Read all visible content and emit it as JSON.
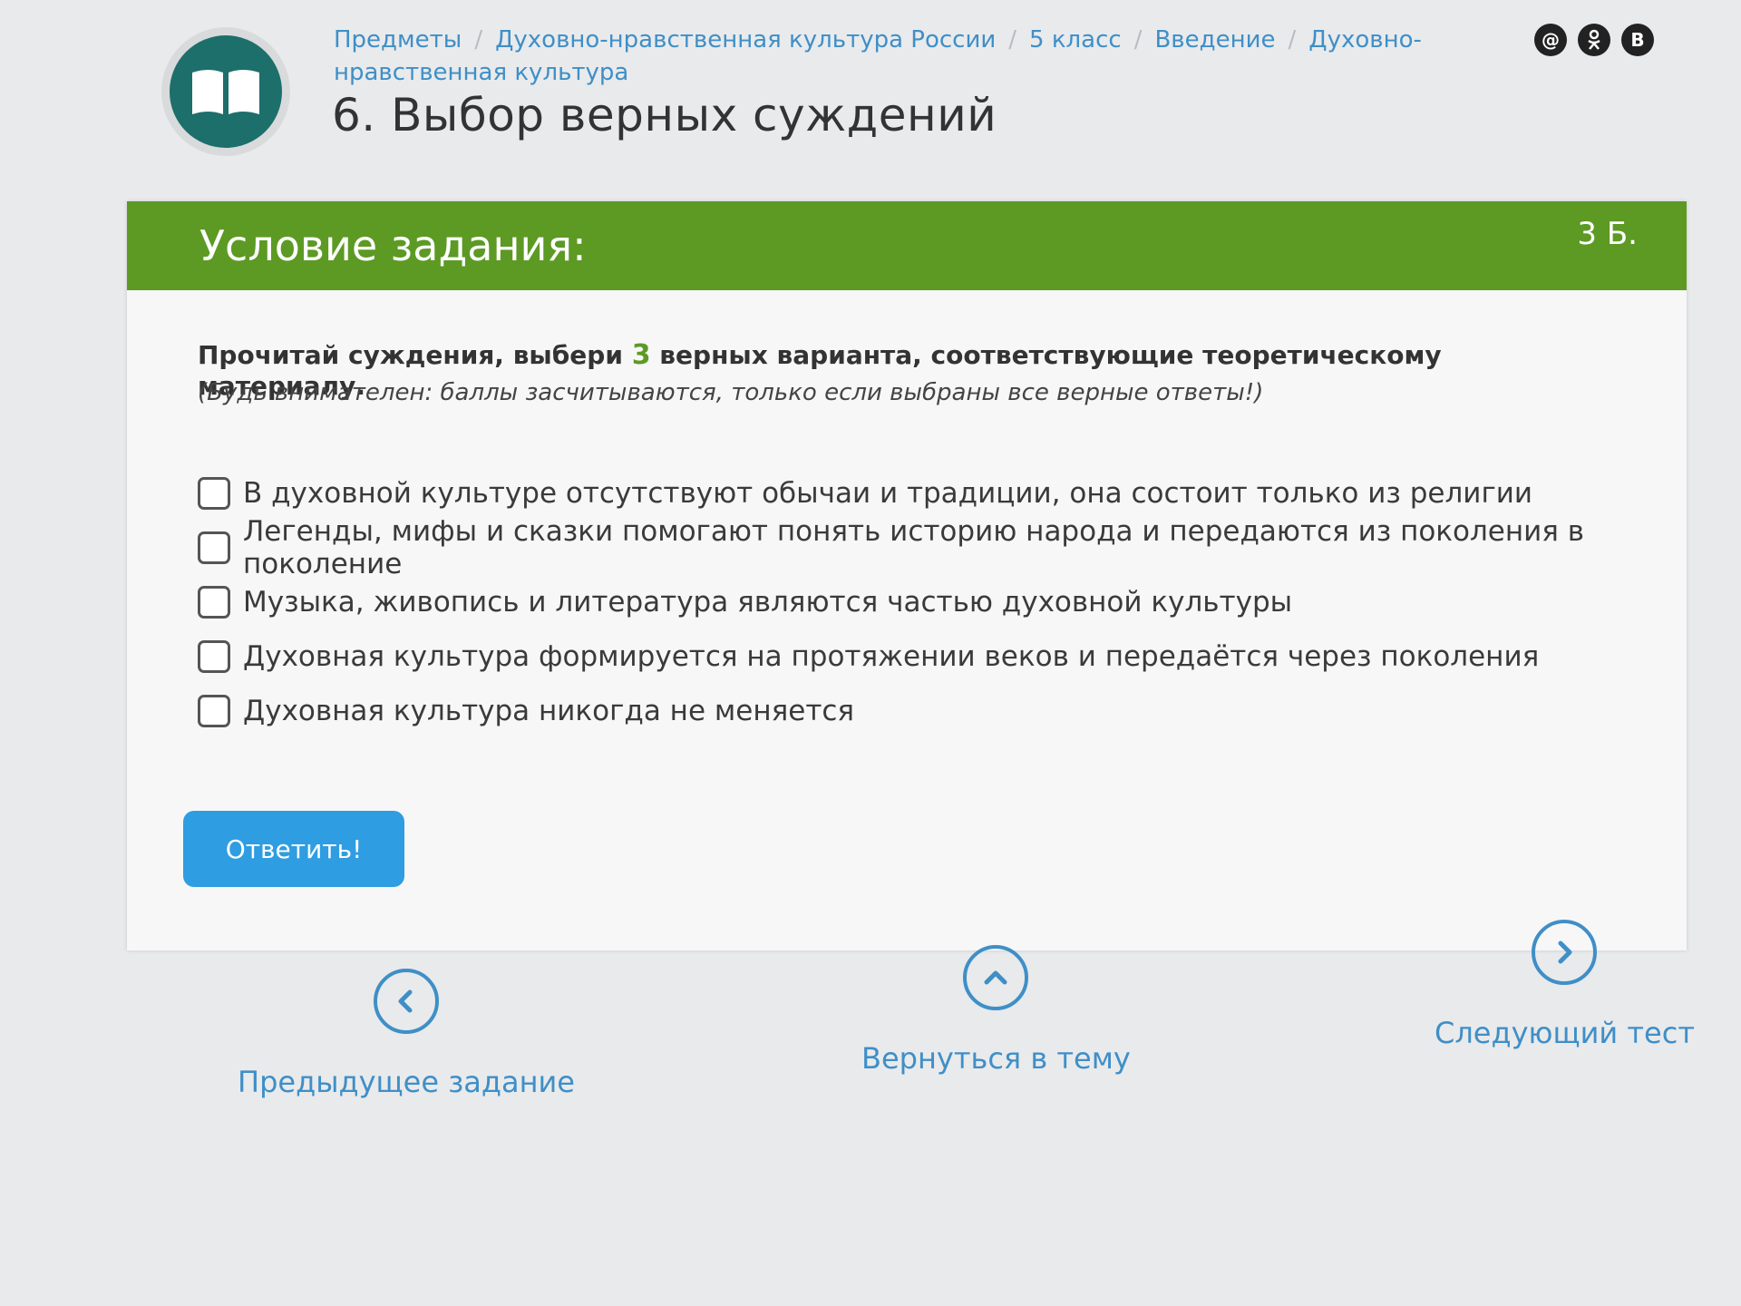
{
  "breadcrumb": {
    "items": [
      "Предметы",
      "Духовно-нравственная культура России",
      "5 класс",
      "Введение",
      "Духовно-нравственная культура"
    ]
  },
  "page": {
    "title": "6. Выбор верных суждений"
  },
  "social": {
    "icons": [
      "mailru-icon",
      "odnoklassniki-icon",
      "vk-icon"
    ],
    "vk_label": "B"
  },
  "task": {
    "header_title": "Условие задания:",
    "points": "3 Б.",
    "instruction_before": "Прочитай суждения, выбери ",
    "instruction_number": "3",
    "instruction_after": " верных варианта, соответствующие теоретическому материалу.",
    "hint": "(Будь внимателен: баллы засчитываются, только если выбраны все верные ответы!)",
    "options": [
      {
        "label": "В духовной культуре отсутствуют обычаи и традиции, она состоит только из религии",
        "checked": false
      },
      {
        "label": "Легенды, мифы и сказки помогают понять историю народа и передаются из поколения в поколение",
        "checked": false
      },
      {
        "label": "Музыка, живопись и литература являются частью духовной культуры",
        "checked": false
      },
      {
        "label": "Духовная культура формируется на протяжении веков и передаётся через поколения",
        "checked": false
      },
      {
        "label": "Духовная культура никогда не меняется",
        "checked": false
      }
    ],
    "submit_label": "Ответить!"
  },
  "navigation": {
    "prev_label": "Предыдущее задание",
    "back_label": "Вернуться в тему",
    "next_label": "Следующий тест"
  },
  "colors": {
    "header_green": "#5c9a24",
    "link_blue": "#3f8fc7",
    "button_blue": "#2f9de2",
    "logo_teal": "#1c6f6b"
  }
}
